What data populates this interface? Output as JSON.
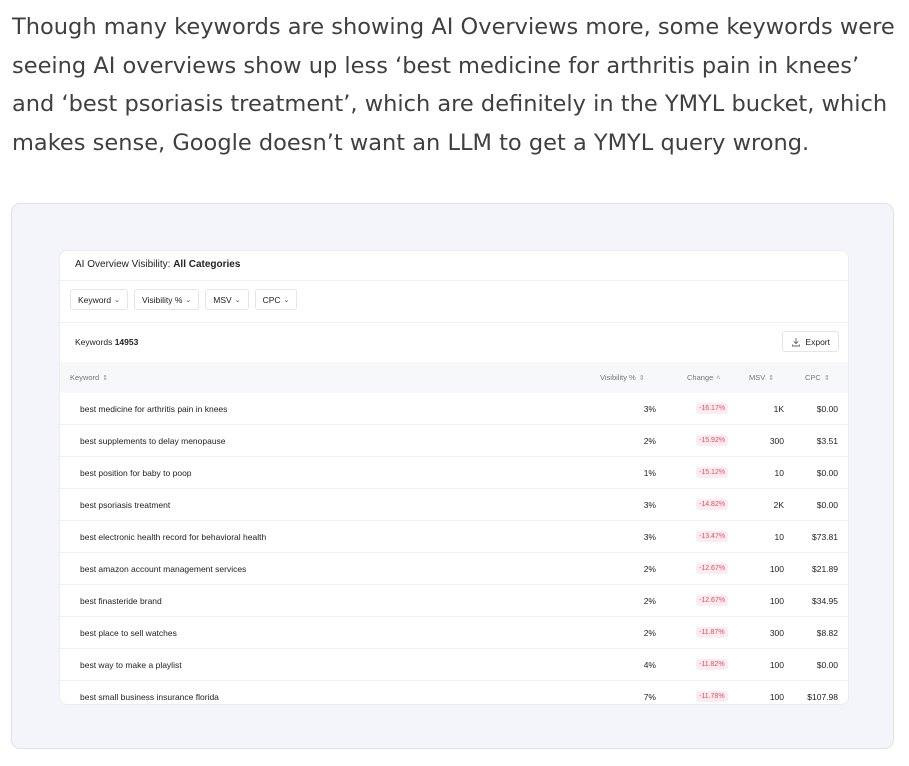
{
  "intro": "Though many keywords are showing AI Overviews more, some keywords were seeing AI overviews show up less ‘best medicine for arthritis pain in knees’ and ‘best psoriasis treatment’, which are definitely in the YMYL bucket, which makes sense, Google doesn’t want an LLM to get a YMYL query wrong.",
  "card": {
    "title_prefix": "AI Overview Visibility: ",
    "title_bold": "All Categories",
    "filters": [
      "Keyword",
      "Visibility %",
      "MSV",
      "CPC"
    ],
    "keywords_label": "Keywords",
    "keywords_count": "14953",
    "export_label": "Export",
    "export_icon": "download-icon"
  },
  "table": {
    "headers": {
      "keyword": "Keyword",
      "visibility": "Visibility %",
      "change": "Change",
      "msv": "MSV",
      "cpc": "CPC"
    },
    "rows": [
      {
        "keyword": "best medicine for arthritis pain in knees",
        "visibility": "3%",
        "change": "-16.17%",
        "msv": "1K",
        "cpc": "$0.00"
      },
      {
        "keyword": "best supplements to delay menopause",
        "visibility": "2%",
        "change": "-15.92%",
        "msv": "300",
        "cpc": "$3.51"
      },
      {
        "keyword": "best position for baby to poop",
        "visibility": "1%",
        "change": "-15.12%",
        "msv": "10",
        "cpc": "$0.00"
      },
      {
        "keyword": "best psoriasis treatment",
        "visibility": "3%",
        "change": "-14.82%",
        "msv": "2K",
        "cpc": "$0.00"
      },
      {
        "keyword": "best electronic health record for behavioral health",
        "visibility": "3%",
        "change": "-13.47%",
        "msv": "10",
        "cpc": "$73.81"
      },
      {
        "keyword": "best amazon account management services",
        "visibility": "2%",
        "change": "-12.67%",
        "msv": "100",
        "cpc": "$21.89"
      },
      {
        "keyword": "best finasteride brand",
        "visibility": "2%",
        "change": "-12.67%",
        "msv": "100",
        "cpc": "$34.95"
      },
      {
        "keyword": "best place to sell watches",
        "visibility": "2%",
        "change": "-11.87%",
        "msv": "300",
        "cpc": "$8.82"
      },
      {
        "keyword": "best way to make a playlist",
        "visibility": "4%",
        "change": "-11.82%",
        "msv": "100",
        "cpc": "$0.00"
      },
      {
        "keyword": "best small business insurance florida",
        "visibility": "7%",
        "change": "-11.78%",
        "msv": "100",
        "cpc": "$107.98"
      }
    ]
  }
}
